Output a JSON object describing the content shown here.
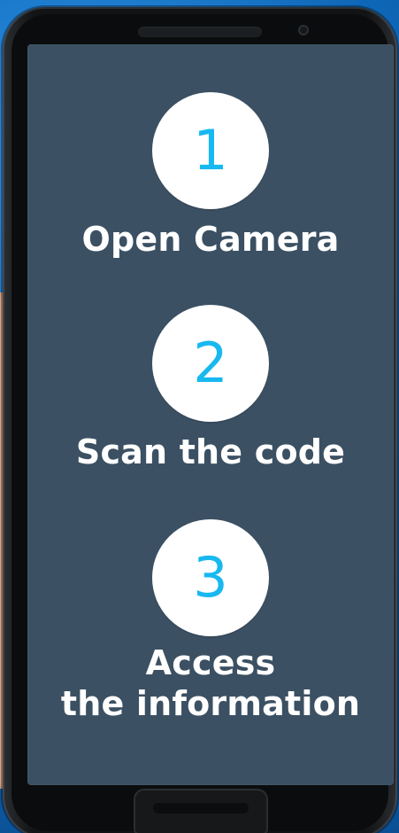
{
  "steps": [
    {
      "number": "1",
      "label": "Open Camera"
    },
    {
      "number": "2",
      "label": "Scan the code"
    },
    {
      "number": "3",
      "label_line_1": "Access",
      "label_line_2": "the information"
    }
  ],
  "colors": {
    "background": "#0f68b8",
    "screen": "#3b5062",
    "circle": "#ffffff",
    "number": "#18b8f0",
    "text": "#ffffff",
    "phone_frame": "#121315"
  }
}
